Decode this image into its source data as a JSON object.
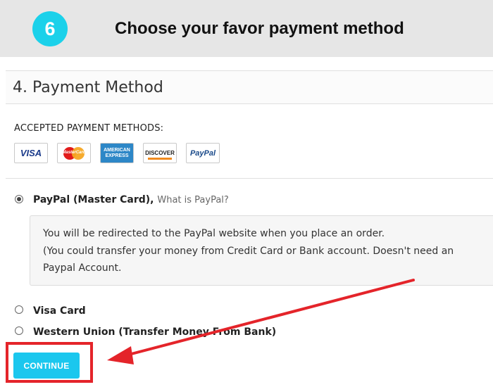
{
  "banner": {
    "step_number": "6",
    "title": "Choose your favor payment method"
  },
  "section": {
    "title": "4. Payment Method"
  },
  "accepted": {
    "label": "ACCEPTED PAYMENT METHODS:",
    "cards": [
      {
        "name": "VISA",
        "icon": "visa-card-icon"
      },
      {
        "name": "MasterCard",
        "icon": "mastercard-icon"
      },
      {
        "name": "AMERICAN EXPRESS",
        "icon": "amex-card-icon"
      },
      {
        "name": "DISCOVER",
        "icon": "discover-card-icon"
      },
      {
        "name": "PayPal",
        "icon": "paypal-card-icon"
      }
    ]
  },
  "options": [
    {
      "label": "PayPal (Master Card),",
      "link": "What is PayPal?",
      "selected": true
    },
    {
      "label": "Visa Card",
      "selected": false
    },
    {
      "label": "Western Union (Transfer Money From Bank)",
      "selected": false
    }
  ],
  "info_box": {
    "line1": "You will be redirected to the PayPal website when you place an order.",
    "line2": "(You could transfer your money from Credit Card or Bank account. Doesn't need an",
    "line3": "Paypal Account."
  },
  "continue_button": {
    "label": "CONTINUE"
  },
  "colors": {
    "accent": "#1bc7ee",
    "highlight": "#e4242a",
    "banner_bg": "#e6e6e6"
  }
}
